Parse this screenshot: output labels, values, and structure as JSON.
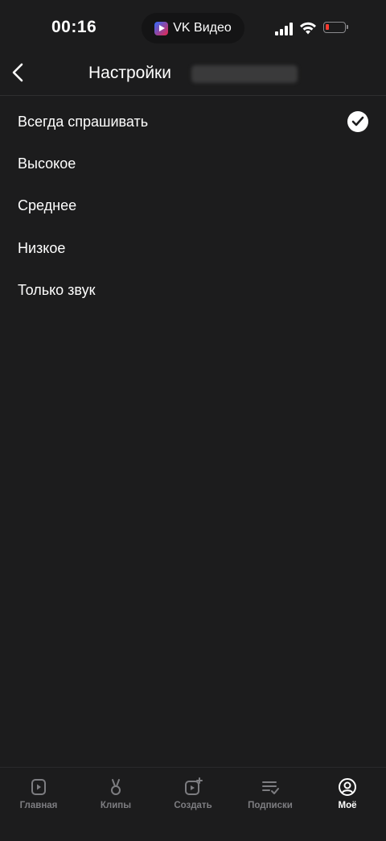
{
  "status_bar": {
    "time": "00:16",
    "app_name": "VK Видео",
    "battery_color": "#ff3b30"
  },
  "header": {
    "title": "Настройки"
  },
  "options": [
    {
      "label": "Всегда спрашивать",
      "selected": true
    },
    {
      "label": "Высокое",
      "selected": false
    },
    {
      "label": "Среднее",
      "selected": false
    },
    {
      "label": "Низкое",
      "selected": false
    },
    {
      "label": "Только звук",
      "selected": false
    }
  ],
  "tabbar": {
    "tabs": [
      {
        "label": "Главная",
        "icon": "play-square-icon",
        "active": false
      },
      {
        "label": "Клипы",
        "icon": "clips-icon",
        "active": false
      },
      {
        "label": "Создать",
        "icon": "create-video-icon",
        "active": false
      },
      {
        "label": "Подписки",
        "icon": "subscriptions-icon",
        "active": false
      },
      {
        "label": "Моё",
        "icon": "profile-icon",
        "active": true
      }
    ]
  },
  "colors": {
    "background": "#1c1c1d",
    "text": "#ffffff",
    "inactive_tab": "#7d7d81"
  }
}
